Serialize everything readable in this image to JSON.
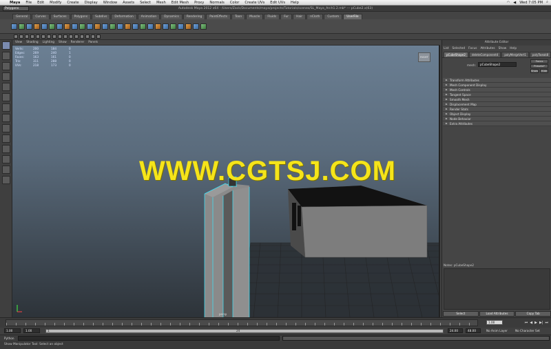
{
  "menubar": {
    "app": "Maya",
    "items": [
      "File",
      "Edit",
      "Modify",
      "Create",
      "Display",
      "Window",
      "Assets",
      "Select",
      "Mesh",
      "Edit Mesh",
      "Proxy",
      "Normals",
      "Color",
      "Create UVs",
      "Edit UVs",
      "Help"
    ],
    "clock": "Wed 7:05 PM"
  },
  "titlebar": {
    "mode": "Polygons",
    "title": "Autodesk Maya 2012 x64 - /Users/Zack/Documents/maya/projects/Tutorials/scenes/SL_Maya_Arch1.2.mb* --- pCube2.x(63)"
  },
  "shelf": {
    "tabs": [
      "General",
      "Curves",
      "Surfaces",
      "Polygons",
      "Subdivs",
      "Deformation",
      "Animation",
      "Dynamics",
      "Rendering",
      "PaintEffects",
      "Toon",
      "Muscle",
      "Fluids",
      "Fur",
      "Hair",
      "nCloth",
      "Custom",
      "UserFile"
    ],
    "active_tab": "UserFile"
  },
  "panel": {
    "menu": [
      "View",
      "Shading",
      "Lighting",
      "Show",
      "Renderer",
      "Panels"
    ],
    "hud": [
      {
        "label": "Verts:",
        "a": "200",
        "b": "184",
        "c": "0"
      },
      {
        "label": "Edges:",
        "a": "269",
        "b": "240",
        "c": "1"
      },
      {
        "label": "Faces:",
        "a": "163",
        "b": "161",
        "c": "0"
      },
      {
        "label": "Tris:",
        "a": "311",
        "b": "288",
        "c": "0"
      },
      {
        "label": "UVs:",
        "a": "218",
        "b": "173",
        "c": "0"
      }
    ],
    "viewcube": "RIGHT",
    "watermark": "WWW.CGTSJ.COM",
    "label_bottom": "persp"
  },
  "attr_editor": {
    "title": "Attribute Editor",
    "menu": [
      "List",
      "Selected",
      "Focus",
      "Attributes",
      "Show",
      "Help"
    ],
    "tabs": [
      "pCubeShape2",
      "deleteComponent4",
      "polyMergeVert1",
      "polyTweak8"
    ],
    "active_tab": "pCubeShape2",
    "mesh_label": "mesh:",
    "mesh_value": "pCubeShape2",
    "focus_btn": "Focus",
    "presets_btn": "Presets*",
    "show_btn": "Show",
    "hide_btn": "Hide",
    "sections": [
      "Transform Attributes",
      "Mesh Component Display",
      "Mesh Controls",
      "Tangent Space",
      "Smooth Mesh",
      "Displacement Map",
      "Render Stats",
      "Object Display",
      "Node Behavior",
      "Extra Attributes"
    ],
    "notes_label": "Notes: pCubeShape2",
    "buttons": [
      "Select",
      "Load Attributes",
      "Copy Tab"
    ]
  },
  "timeline": {
    "current_frame": "1.00",
    "range_start": "1.00",
    "range_inner_start": "1.00",
    "range_bar_start": "1",
    "range_bar_end": "24",
    "range_end": "24.00",
    "range_out": "48.00",
    "anim_layer": "No Anim Layer",
    "char_set": "No Character Set"
  },
  "cmdline": {
    "lang": "Python"
  },
  "helpline": {
    "text": "Show Manipulator Tool: Select an object"
  }
}
